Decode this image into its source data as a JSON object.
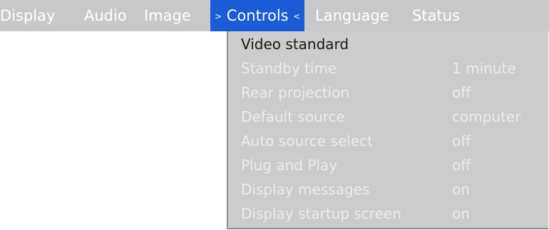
{
  "menu": {
    "tabs": [
      {
        "label": "Display"
      },
      {
        "label": "Audio"
      },
      {
        "label": "Image"
      },
      {
        "label": "Controls",
        "active": true
      },
      {
        "label": "Language"
      },
      {
        "label": "Status"
      }
    ],
    "active_left_marker": ">",
    "active_right_marker": "<"
  },
  "controls_menu": {
    "items": [
      {
        "label": "Video standard",
        "value": ""
      },
      {
        "label": "Standby time",
        "value": "1 minute"
      },
      {
        "label": "Rear projection",
        "value": "off"
      },
      {
        "label": "Default source",
        "value": "computer"
      },
      {
        "label": "Auto source select",
        "value": "off"
      },
      {
        "label": "Plug and Play",
        "value": "off"
      },
      {
        "label": "Display messages",
        "value": "on"
      },
      {
        "label": "Display startup screen",
        "value": "on"
      }
    ]
  },
  "colors": {
    "menubar_bg": "#c9c9c9",
    "active_tab_bg": "#1b5bd8",
    "dropdown_bg": "#cccccc",
    "inactive_text": "#ececec",
    "selected_text": "#1a1a1a"
  }
}
